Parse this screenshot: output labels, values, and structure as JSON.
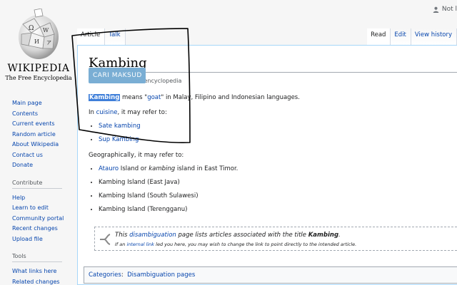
{
  "personal": {
    "label": "Not l"
  },
  "logo": {
    "wordmark": "Wikipedia",
    "wordmark_display": "WIKIPEDIA",
    "tagline": "The Free Encyclopedia"
  },
  "nav": {
    "items": [
      "Main page",
      "Current events",
      "Current events",
      "Random article",
      "About Wikipedia",
      "Contact us",
      "Donate"
    ],
    "main": [
      "Main page",
      "Contents",
      "Current events",
      "Random article",
      "About Wikipedia",
      "Contact us",
      "Donate"
    ],
    "contribute_heading": "Contribute",
    "contribute": [
      "Help",
      "Learn to edit",
      "Community portal",
      "Recent changes",
      "Upload file"
    ],
    "tools_heading": "Tools",
    "tools": [
      "What links here",
      "Related changes"
    ]
  },
  "tabs": {
    "article": "Article",
    "talk": "Talk",
    "read": "Read",
    "edit": "Edit",
    "history": "View history"
  },
  "page": {
    "title": "Kambing",
    "subtitle": "From Wikipedia, the free encyclopedia",
    "subtitle_visible": "ree encyclopedia",
    "cari_button": "CARI MAKSUD",
    "p1_word": "Kambing",
    "p1_a": " means \"",
    "p1_link": "goat",
    "p1_b": "\" in Malay, Filipino and Indonesian languages.",
    "p2_a": "In ",
    "p2_link": "cuisine",
    "p2_b": ", it may refer to:",
    "cuisine_items": [
      "Sate kambing",
      "Sup Kambing"
    ],
    "p3": "Geographically, it may refer to:",
    "geo_first_link": "Atauro",
    "geo_first_a": " Island or ",
    "geo_first_em": "kambing",
    "geo_first_b": " island in East Timor.",
    "geo_items": [
      "Kambing Island (East Java)",
      "Kambing Island (South Sulawesi)",
      "Kambing Island (Terengganu)"
    ],
    "dab_a": "This ",
    "dab_link": "disambiguation",
    "dab_b": " page lists articles associated with the title ",
    "dab_title": "Kambing",
    "dab_c": ".",
    "dab2_a": "If an ",
    "dab2_link": "internal link",
    "dab2_b": " led you here, you may wish to change the link to point directly to the intended article.",
    "categories_label": "Categories",
    "categories_sep": ":",
    "category": "Disambiguation pages"
  },
  "colors": {
    "link": "#0645ad",
    "highlight": "#3f7fd9",
    "cari_button": "#7aaed4",
    "annotation": "#000000"
  }
}
